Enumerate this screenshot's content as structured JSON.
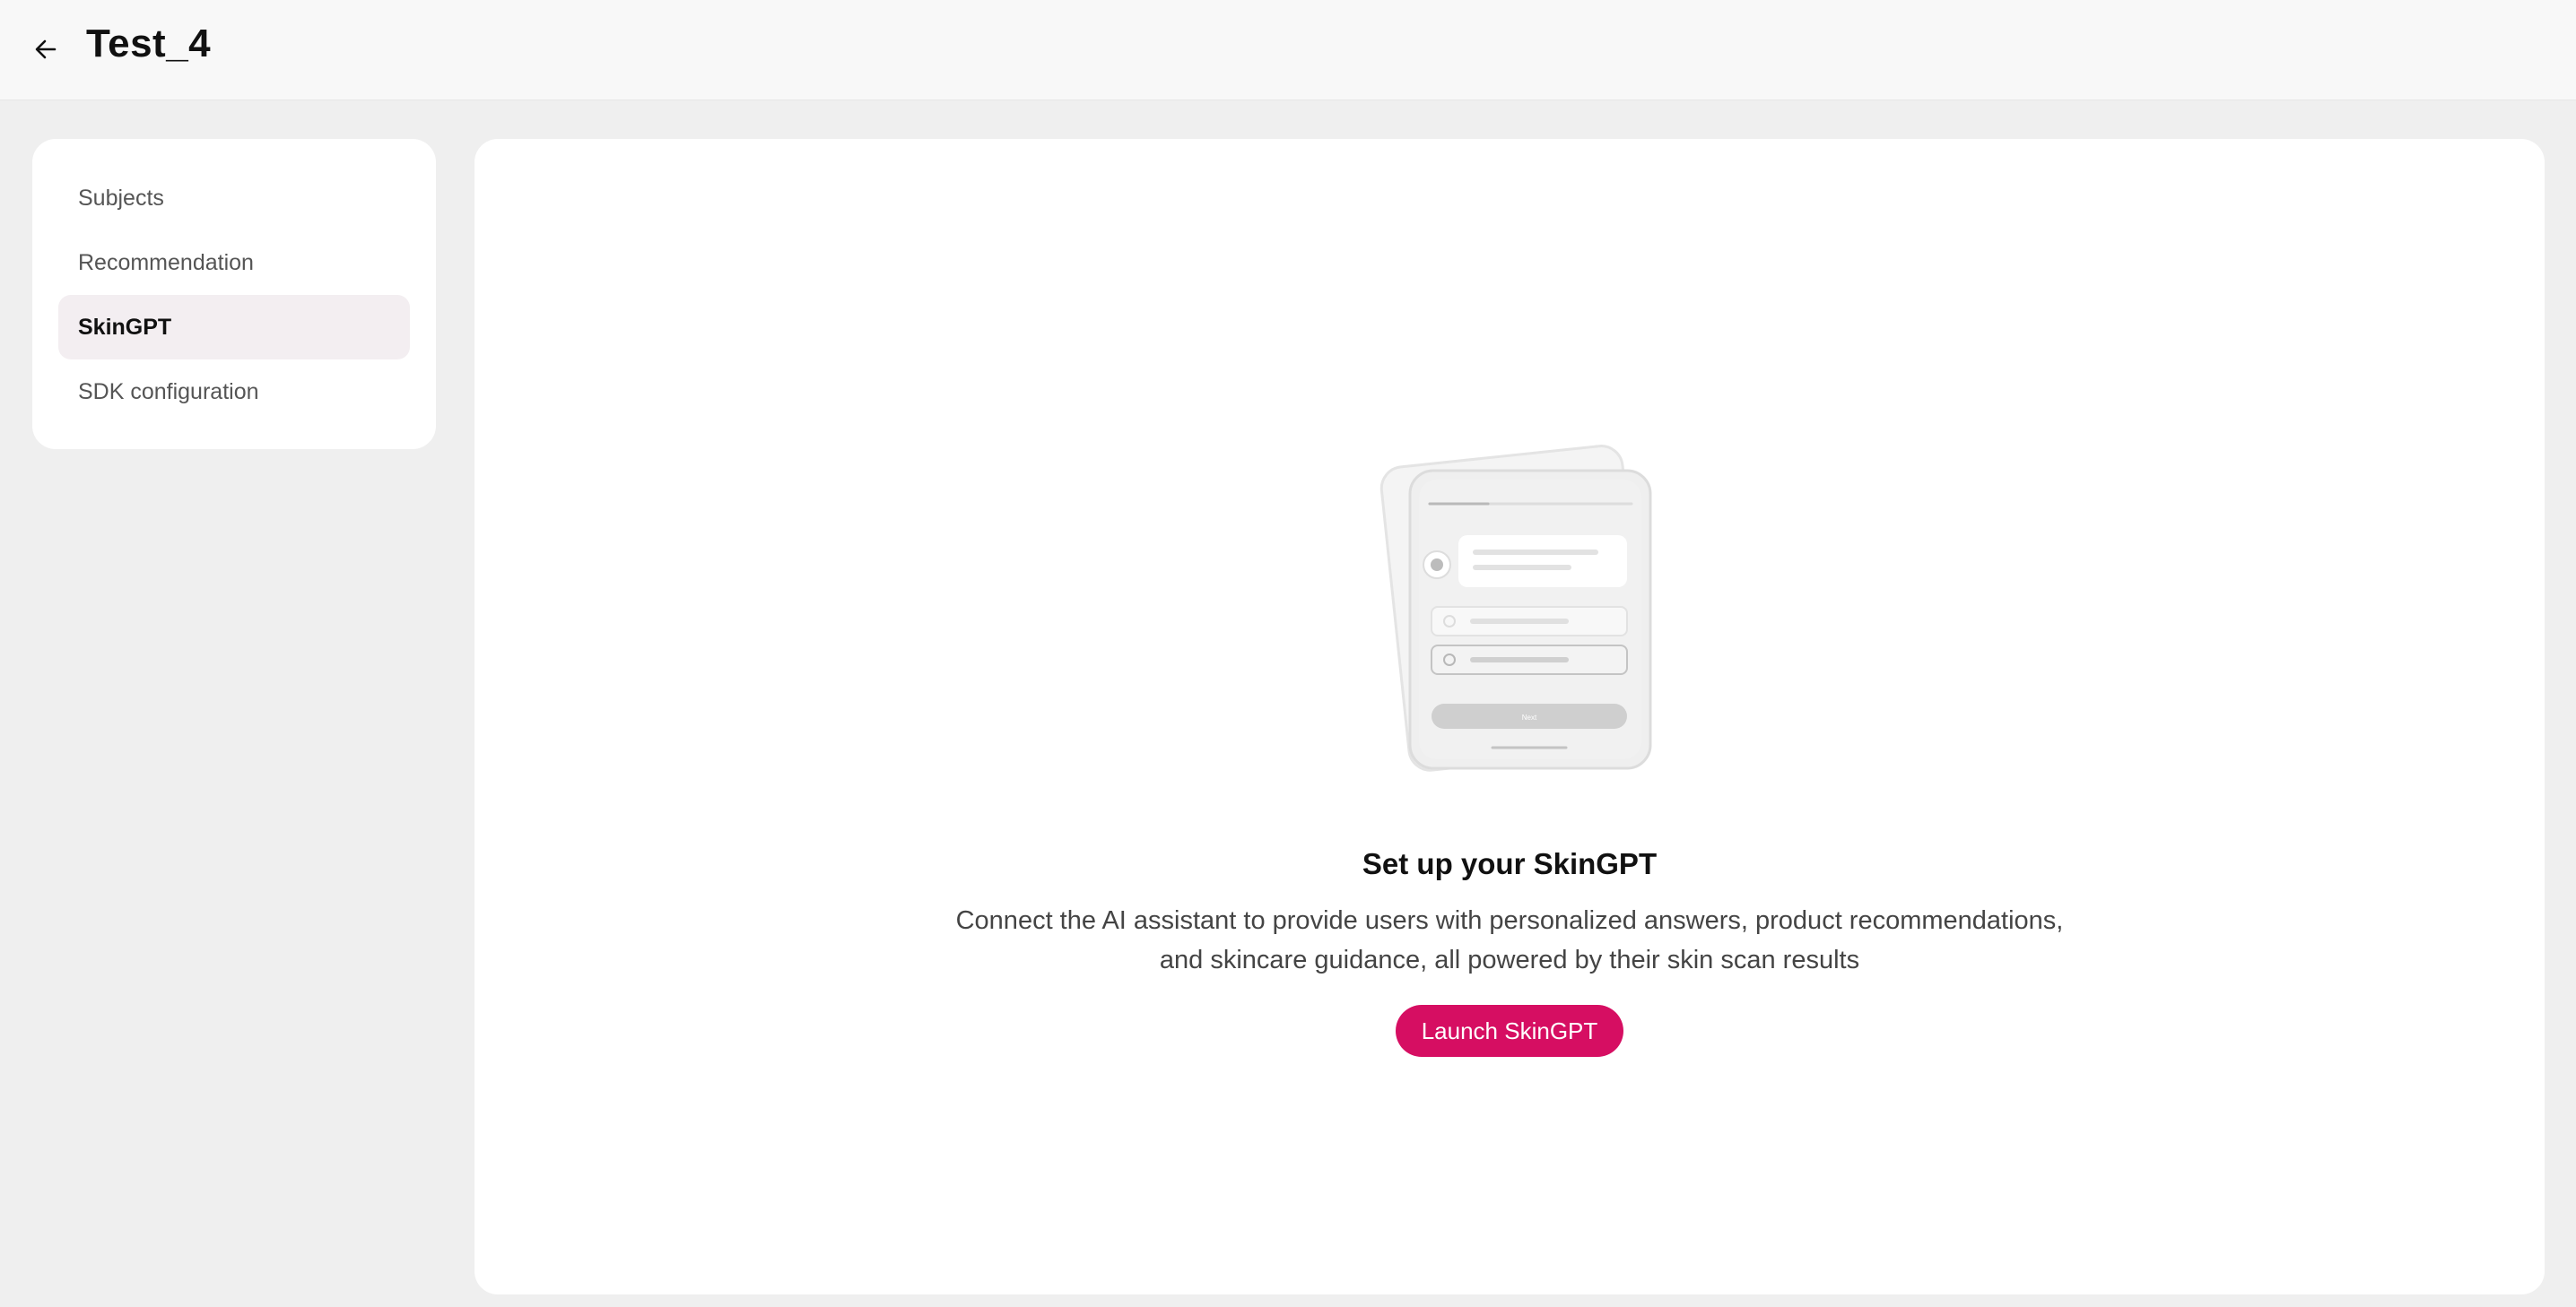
{
  "header": {
    "back_icon": "arrow-left-icon",
    "title": "Test_4"
  },
  "sidebar": {
    "items": [
      {
        "label": "Subjects",
        "active": false
      },
      {
        "label": "Recommendation",
        "active": false
      },
      {
        "label": "SkinGPT",
        "active": true
      },
      {
        "label": "SDK configuration",
        "active": false
      }
    ]
  },
  "main": {
    "illustration": "phone-chat-illustration",
    "illustration_button_label": "Next",
    "title": "Set up your SkinGPT",
    "description_line1": "Connect the AI assistant to provide users with personalized answers, product recommendations,",
    "description_line2": "and skincare guidance, all powered by their skin scan results",
    "cta_label": "Launch SkinGPT"
  },
  "colors": {
    "accent": "#d60e62",
    "active_nav_bg": "#f3eef1",
    "page_bg": "#efefef"
  }
}
